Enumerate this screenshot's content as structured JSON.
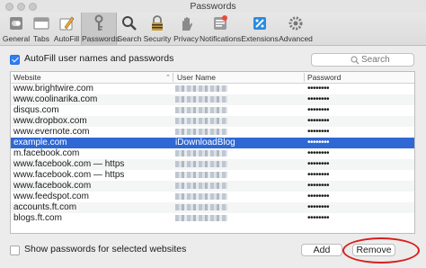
{
  "window": {
    "title": "Passwords"
  },
  "toolbar": {
    "items": [
      {
        "label": "General",
        "icon": "switch-icon"
      },
      {
        "label": "Tabs",
        "icon": "tabs-icon"
      },
      {
        "label": "AutoFill",
        "icon": "pencil-icon"
      },
      {
        "label": "Passwords",
        "icon": "key-icon",
        "selected": true
      },
      {
        "label": "Search",
        "icon": "search-icon"
      },
      {
        "label": "Security",
        "icon": "lock-icon"
      },
      {
        "label": "Privacy",
        "icon": "hand-icon"
      },
      {
        "label": "Notifications",
        "icon": "bell-icon"
      },
      {
        "label": "Extensions",
        "icon": "puzzle-icon"
      },
      {
        "label": "Advanced",
        "icon": "gears-icon"
      }
    ]
  },
  "autofill": {
    "label": "AutoFill user names and passwords",
    "checked": true
  },
  "search": {
    "placeholder": "Search"
  },
  "table": {
    "columns": [
      "Website",
      "User Name",
      "Password"
    ],
    "rows": [
      {
        "website": "www.brightwire.com",
        "username": "",
        "password": "••••••••"
      },
      {
        "website": "www.coolinarika.com",
        "username": "",
        "password": "••••••••"
      },
      {
        "website": "disqus.com",
        "username": "",
        "password": "••••••••"
      },
      {
        "website": "www.dropbox.com",
        "username": "",
        "password": "••••••••"
      },
      {
        "website": "www.evernote.com",
        "username": "",
        "password": "••••••••"
      },
      {
        "website": "example.com",
        "username": "iDownloadBlog",
        "password": "••••••••",
        "selected": true
      },
      {
        "website": "m.facebook.com",
        "username": "",
        "password": "••••••••"
      },
      {
        "website": "www.facebook.com — https",
        "username": "",
        "password": "••••••••"
      },
      {
        "website": "www.facebook.com — https",
        "username": "",
        "password": "••••••••"
      },
      {
        "website": "www.facebook.com",
        "username": "",
        "password": "••••••••"
      },
      {
        "website": "www.feedspot.com",
        "username": "",
        "password": "••••••••"
      },
      {
        "website": "accounts.ft.com",
        "username": "",
        "password": "••••••••"
      },
      {
        "website": "blogs.ft.com",
        "username": "",
        "password": "••••••••"
      }
    ]
  },
  "show_passwords": {
    "label": "Show passwords for selected websites",
    "checked": false
  },
  "buttons": {
    "add": "Add",
    "remove": "Remove"
  },
  "colors": {
    "selection": "#2f68d4",
    "annotation": "#d81e1e",
    "checkbox": "#2f7ef5"
  }
}
